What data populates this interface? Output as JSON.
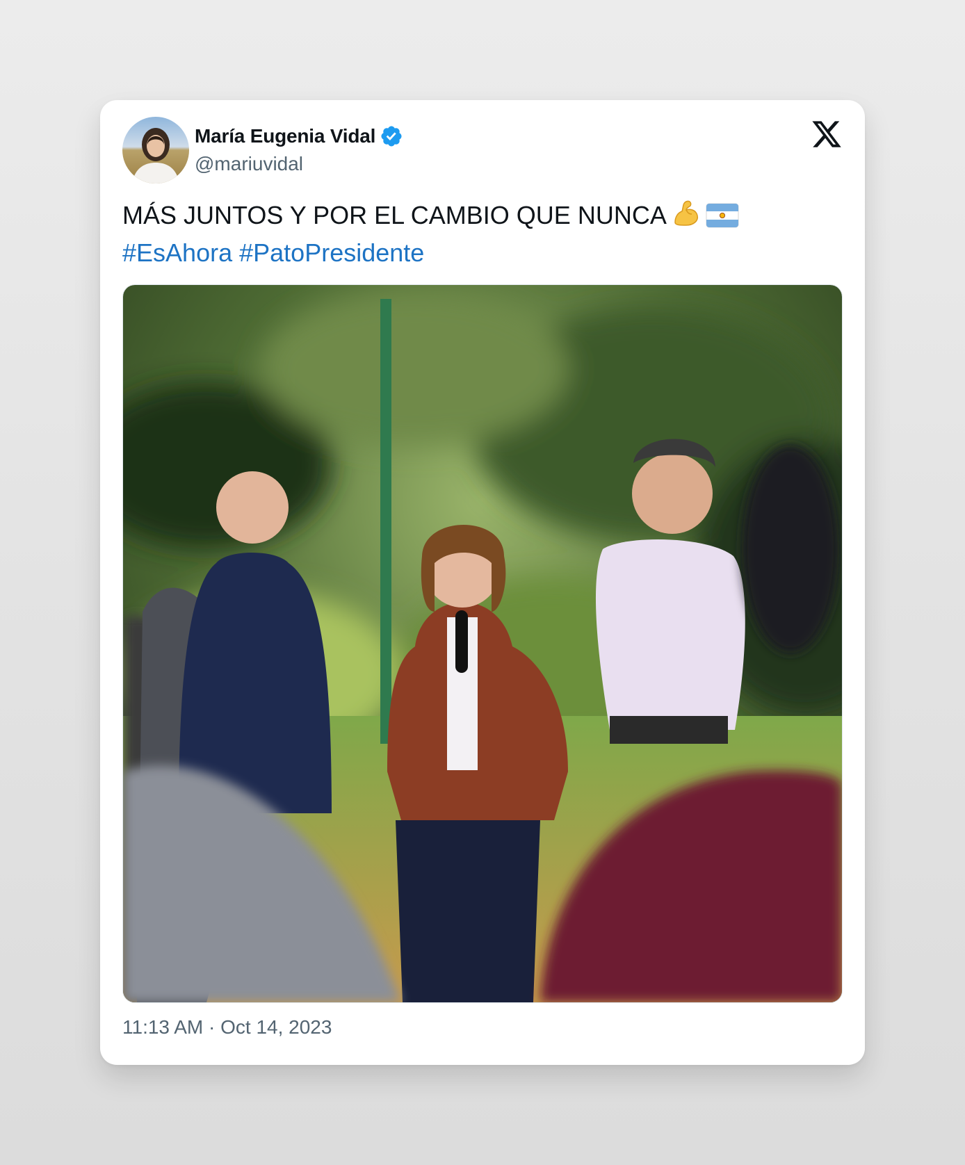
{
  "tweet": {
    "display_name": "María Eugenia Vidal",
    "handle": "@mariuvidal",
    "text_main": "MÁS JUNTOS Y POR EL CAMBIO QUE NUNCA",
    "hashtags": [
      "#EsAhora",
      "#PatoPresidente"
    ],
    "emojis": [
      "flexed-biceps",
      "argentina-flag"
    ],
    "time": "11:13 AM",
    "separator": "·",
    "date": "Oct 14, 2023"
  },
  "colors": {
    "verified": "#1d9bf0",
    "hashtag": "#1d73c4",
    "secondary_text": "#536471",
    "primary_text": "#0f1419"
  }
}
